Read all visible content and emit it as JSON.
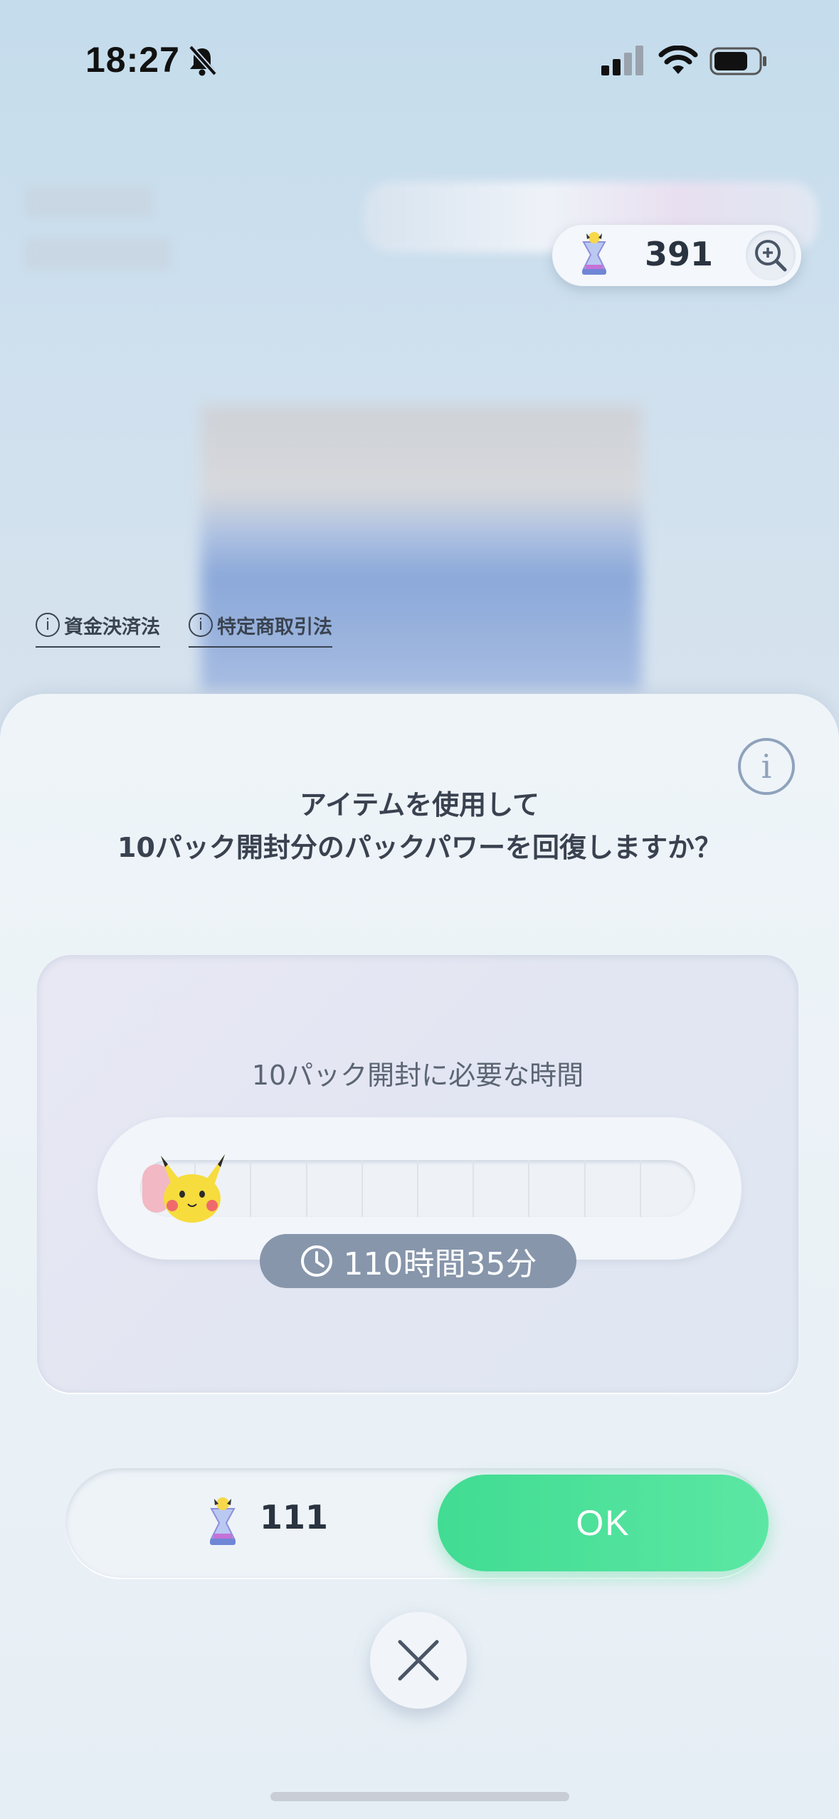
{
  "status_bar": {
    "time": "18:27",
    "icons": [
      "bell-slash-icon",
      "signal-icon",
      "wifi-icon",
      "battery-icon"
    ]
  },
  "currency": {
    "amount": "391",
    "icon": "hourglass-icon"
  },
  "legal_links": [
    {
      "label": "資金決済法"
    },
    {
      "label": "特定商取引法"
    }
  ],
  "dialog": {
    "question_line1": "アイテムを使用して",
    "question_line2": "10パック開封分のパックパワーを回復しますか？",
    "panel_title": "10パック開封に必要な時間",
    "progress": {
      "filled_segments": 0.25,
      "total_segments": 10
    },
    "time_needed": "110時間35分",
    "item_amount": "111",
    "ok_label": "OK"
  },
  "colors": {
    "ok_green": "#4fe39c",
    "badge_gray": "#8796ab",
    "text_dark": "#3a4250"
  }
}
